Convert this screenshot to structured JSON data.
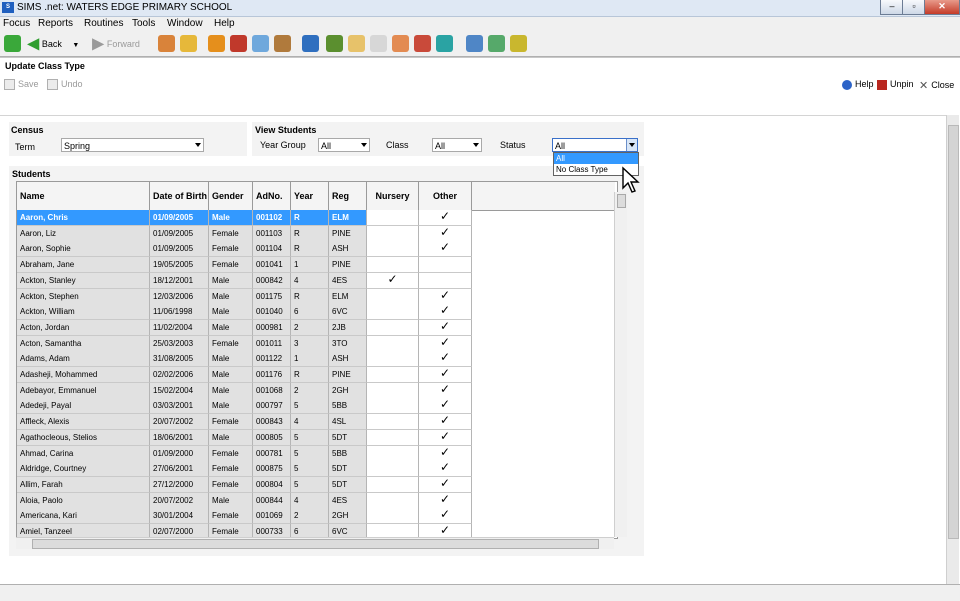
{
  "window": {
    "title": "SIMS .net: WATERS EDGE PRIMARY SCHOOL",
    "logo": "S",
    "controls": [
      "minimize-icon",
      "maximize-icon",
      "close-icon"
    ]
  },
  "menu": [
    "Focus",
    "Reports",
    "Routines",
    "Tools",
    "Window",
    "Help"
  ],
  "toolbar": {
    "back_label": "Back",
    "forward_label": "Forward"
  },
  "panel": {
    "title": "Update Class Type",
    "save_label": "Save",
    "undo_label": "Undo",
    "help_label": "Help",
    "unpin_label": "Unpin",
    "close_label": "Close"
  },
  "census": {
    "heading": "Census",
    "term_label": "Term",
    "term_value": "Spring"
  },
  "view_students": {
    "heading": "View Students",
    "year_group_label": "Year Group",
    "year_group_value": "All",
    "class_label": "Class",
    "class_value": "All",
    "status_label": "Status",
    "status_value": "All",
    "status_options": [
      "All",
      "No Class Type"
    ],
    "status_selected_index": 0
  },
  "students": {
    "heading": "Students",
    "columns": [
      "Name",
      "Date of Birth",
      "Gender",
      "AdNo.",
      "Year",
      "Reg",
      "Nursery",
      "Other"
    ],
    "check_glyph": "✓",
    "rows": [
      {
        "name": "Aaron, Chris",
        "dob": "01/09/2005",
        "gender": "Male",
        "adno": "001102",
        "year": "R",
        "reg": "ELM",
        "nursery": false,
        "other": true,
        "selected": true
      },
      {
        "name": "Aaron, Liz",
        "dob": "01/09/2005",
        "gender": "Female",
        "adno": "001103",
        "year": "R",
        "reg": "PINE",
        "nursery": false,
        "other": true
      },
      {
        "name": "Aaron, Sophie",
        "dob": "01/09/2005",
        "gender": "Female",
        "adno": "001104",
        "year": "R",
        "reg": "ASH",
        "nursery": false,
        "other": true
      },
      {
        "name": "Abraham, Jane",
        "dob": "19/05/2005",
        "gender": "Female",
        "adno": "001041",
        "year": "1",
        "reg": "PINE",
        "nursery": false,
        "other": false
      },
      {
        "name": "Ackton, Stanley",
        "dob": "18/12/2001",
        "gender": "Male",
        "adno": "000842",
        "year": "4",
        "reg": "4ES",
        "nursery": true,
        "other": false
      },
      {
        "name": "Ackton, Stephen",
        "dob": "12/03/2006",
        "gender": "Male",
        "adno": "001175",
        "year": "R",
        "reg": "ELM",
        "nursery": false,
        "other": true
      },
      {
        "name": "Ackton, William",
        "dob": "11/06/1998",
        "gender": "Male",
        "adno": "001040",
        "year": "6",
        "reg": "6VC",
        "nursery": false,
        "other": true
      },
      {
        "name": "Acton, Jordan",
        "dob": "11/02/2004",
        "gender": "Male",
        "adno": "000981",
        "year": "2",
        "reg": "2JB",
        "nursery": false,
        "other": true
      },
      {
        "name": "Acton, Samantha",
        "dob": "25/03/2003",
        "gender": "Female",
        "adno": "001011",
        "year": "3",
        "reg": "3TO",
        "nursery": false,
        "other": true
      },
      {
        "name": "Adams, Adam",
        "dob": "31/08/2005",
        "gender": "Male",
        "adno": "001122",
        "year": "1",
        "reg": "ASH",
        "nursery": false,
        "other": true
      },
      {
        "name": "Adasheji, Mohammed",
        "dob": "02/02/2006",
        "gender": "Male",
        "adno": "001176",
        "year": "R",
        "reg": "PINE",
        "nursery": false,
        "other": true
      },
      {
        "name": "Adebayor, Emmanuel",
        "dob": "15/02/2004",
        "gender": "Male",
        "adno": "001068",
        "year": "2",
        "reg": "2GH",
        "nursery": false,
        "other": true
      },
      {
        "name": "Adedeji, Payal",
        "dob": "03/03/2001",
        "gender": "Male",
        "adno": "000797",
        "year": "5",
        "reg": "5BB",
        "nursery": false,
        "other": true
      },
      {
        "name": "Affleck, Alexis",
        "dob": "20/07/2002",
        "gender": "Female",
        "adno": "000843",
        "year": "4",
        "reg": "4SL",
        "nursery": false,
        "other": true
      },
      {
        "name": "Agathocleous, Stelios",
        "dob": "18/06/2001",
        "gender": "Male",
        "adno": "000805",
        "year": "5",
        "reg": "5DT",
        "nursery": false,
        "other": true
      },
      {
        "name": "Ahmad, Carina",
        "dob": "01/09/2000",
        "gender": "Female",
        "adno": "000781",
        "year": "5",
        "reg": "5BB",
        "nursery": false,
        "other": true
      },
      {
        "name": "Aldridge, Courtney",
        "dob": "27/06/2001",
        "gender": "Female",
        "adno": "000875",
        "year": "5",
        "reg": "5DT",
        "nursery": false,
        "other": true
      },
      {
        "name": "Allim, Farah",
        "dob": "27/12/2000",
        "gender": "Female",
        "adno": "000804",
        "year": "5",
        "reg": "5DT",
        "nursery": false,
        "other": true
      },
      {
        "name": "Aloia, Paolo",
        "dob": "20/07/2002",
        "gender": "Male",
        "adno": "000844",
        "year": "4",
        "reg": "4ES",
        "nursery": false,
        "other": true
      },
      {
        "name": "Americana, Kari",
        "dob": "30/01/2004",
        "gender": "Female",
        "adno": "001069",
        "year": "2",
        "reg": "2GH",
        "nursery": false,
        "other": true
      },
      {
        "name": "Amiel, Tanzeel",
        "dob": "02/07/2000",
        "gender": "Female",
        "adno": "000733",
        "year": "6",
        "reg": "6VC",
        "nursery": false,
        "other": true
      }
    ]
  },
  "colors": {
    "selection": "#3399ff",
    "grey_cell": "#e1e1e1",
    "chrome": "#f0f0f0"
  }
}
